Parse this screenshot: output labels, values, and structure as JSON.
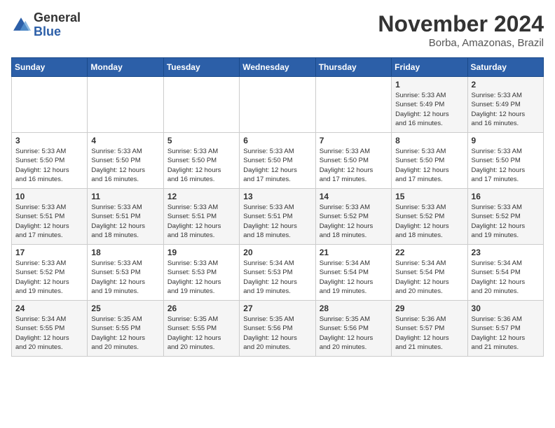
{
  "header": {
    "logo_general": "General",
    "logo_blue": "Blue",
    "month_title": "November 2024",
    "subtitle": "Borba, Amazonas, Brazil"
  },
  "days_of_week": [
    "Sunday",
    "Monday",
    "Tuesday",
    "Wednesday",
    "Thursday",
    "Friday",
    "Saturday"
  ],
  "weeks": [
    [
      {
        "day": "",
        "info": ""
      },
      {
        "day": "",
        "info": ""
      },
      {
        "day": "",
        "info": ""
      },
      {
        "day": "",
        "info": ""
      },
      {
        "day": "",
        "info": ""
      },
      {
        "day": "1",
        "info": "Sunrise: 5:33 AM\nSunset: 5:49 PM\nDaylight: 12 hours\nand 16 minutes."
      },
      {
        "day": "2",
        "info": "Sunrise: 5:33 AM\nSunset: 5:49 PM\nDaylight: 12 hours\nand 16 minutes."
      }
    ],
    [
      {
        "day": "3",
        "info": "Sunrise: 5:33 AM\nSunset: 5:50 PM\nDaylight: 12 hours\nand 16 minutes."
      },
      {
        "day": "4",
        "info": "Sunrise: 5:33 AM\nSunset: 5:50 PM\nDaylight: 12 hours\nand 16 minutes."
      },
      {
        "day": "5",
        "info": "Sunrise: 5:33 AM\nSunset: 5:50 PM\nDaylight: 12 hours\nand 16 minutes."
      },
      {
        "day": "6",
        "info": "Sunrise: 5:33 AM\nSunset: 5:50 PM\nDaylight: 12 hours\nand 17 minutes."
      },
      {
        "day": "7",
        "info": "Sunrise: 5:33 AM\nSunset: 5:50 PM\nDaylight: 12 hours\nand 17 minutes."
      },
      {
        "day": "8",
        "info": "Sunrise: 5:33 AM\nSunset: 5:50 PM\nDaylight: 12 hours\nand 17 minutes."
      },
      {
        "day": "9",
        "info": "Sunrise: 5:33 AM\nSunset: 5:50 PM\nDaylight: 12 hours\nand 17 minutes."
      }
    ],
    [
      {
        "day": "10",
        "info": "Sunrise: 5:33 AM\nSunset: 5:51 PM\nDaylight: 12 hours\nand 17 minutes."
      },
      {
        "day": "11",
        "info": "Sunrise: 5:33 AM\nSunset: 5:51 PM\nDaylight: 12 hours\nand 18 minutes."
      },
      {
        "day": "12",
        "info": "Sunrise: 5:33 AM\nSunset: 5:51 PM\nDaylight: 12 hours\nand 18 minutes."
      },
      {
        "day": "13",
        "info": "Sunrise: 5:33 AM\nSunset: 5:51 PM\nDaylight: 12 hours\nand 18 minutes."
      },
      {
        "day": "14",
        "info": "Sunrise: 5:33 AM\nSunset: 5:52 PM\nDaylight: 12 hours\nand 18 minutes."
      },
      {
        "day": "15",
        "info": "Sunrise: 5:33 AM\nSunset: 5:52 PM\nDaylight: 12 hours\nand 18 minutes."
      },
      {
        "day": "16",
        "info": "Sunrise: 5:33 AM\nSunset: 5:52 PM\nDaylight: 12 hours\nand 19 minutes."
      }
    ],
    [
      {
        "day": "17",
        "info": "Sunrise: 5:33 AM\nSunset: 5:52 PM\nDaylight: 12 hours\nand 19 minutes."
      },
      {
        "day": "18",
        "info": "Sunrise: 5:33 AM\nSunset: 5:53 PM\nDaylight: 12 hours\nand 19 minutes."
      },
      {
        "day": "19",
        "info": "Sunrise: 5:33 AM\nSunset: 5:53 PM\nDaylight: 12 hours\nand 19 minutes."
      },
      {
        "day": "20",
        "info": "Sunrise: 5:34 AM\nSunset: 5:53 PM\nDaylight: 12 hours\nand 19 minutes."
      },
      {
        "day": "21",
        "info": "Sunrise: 5:34 AM\nSunset: 5:54 PM\nDaylight: 12 hours\nand 19 minutes."
      },
      {
        "day": "22",
        "info": "Sunrise: 5:34 AM\nSunset: 5:54 PM\nDaylight: 12 hours\nand 20 minutes."
      },
      {
        "day": "23",
        "info": "Sunrise: 5:34 AM\nSunset: 5:54 PM\nDaylight: 12 hours\nand 20 minutes."
      }
    ],
    [
      {
        "day": "24",
        "info": "Sunrise: 5:34 AM\nSunset: 5:55 PM\nDaylight: 12 hours\nand 20 minutes."
      },
      {
        "day": "25",
        "info": "Sunrise: 5:35 AM\nSunset: 5:55 PM\nDaylight: 12 hours\nand 20 minutes."
      },
      {
        "day": "26",
        "info": "Sunrise: 5:35 AM\nSunset: 5:55 PM\nDaylight: 12 hours\nand 20 minutes."
      },
      {
        "day": "27",
        "info": "Sunrise: 5:35 AM\nSunset: 5:56 PM\nDaylight: 12 hours\nand 20 minutes."
      },
      {
        "day": "28",
        "info": "Sunrise: 5:35 AM\nSunset: 5:56 PM\nDaylight: 12 hours\nand 20 minutes."
      },
      {
        "day": "29",
        "info": "Sunrise: 5:36 AM\nSunset: 5:57 PM\nDaylight: 12 hours\nand 21 minutes."
      },
      {
        "day": "30",
        "info": "Sunrise: 5:36 AM\nSunset: 5:57 PM\nDaylight: 12 hours\nand 21 minutes."
      }
    ]
  ]
}
